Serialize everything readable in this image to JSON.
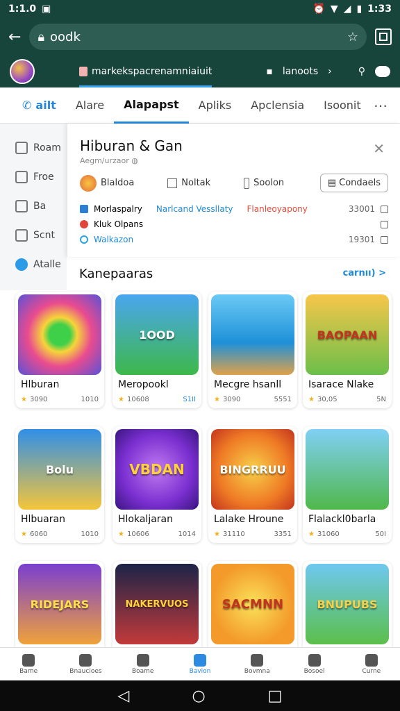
{
  "status": {
    "time": "1:1.0",
    "right_time": "1:33",
    "icons": [
      "photo-icon",
      "alarm-icon",
      "wifi-icon",
      "signal-icon",
      "battery-icon"
    ]
  },
  "browser": {
    "url": "oodk"
  },
  "header": {
    "site": "markekspacrenamniaiuit",
    "right_label": "lanoots"
  },
  "tabs": [
    "ailt",
    "Alare",
    "Alapapst",
    "Apliks",
    "Apclensia",
    "Isoonit"
  ],
  "active_tab": 2,
  "sidebar": [
    "Roam",
    "Froe",
    "Ba",
    "Scnt",
    "Atalle"
  ],
  "panel": {
    "title": "Hiburan & Gan",
    "subtitle": "Aegm/urzaor",
    "row1": [
      "Blaldoa",
      "Noltak",
      "Soolon"
    ],
    "button": "Condaels",
    "list": [
      {
        "a": "Morlaspalry",
        "b": "Narlcand Vessllaty",
        "c": "Flanleoyapony",
        "num": "33001"
      },
      {
        "a": "Kluk Olpans",
        "b": "",
        "c": "",
        "num": ""
      },
      {
        "a": "Walkazon",
        "b": "",
        "c": "",
        "num": "19301"
      }
    ]
  },
  "section": {
    "title": "Kanepaaras",
    "link": "carnıı) >"
  },
  "cards": [
    {
      "name": "Hlburan",
      "rating": "3090",
      "count": "1010",
      "thumb": ""
    },
    {
      "name": "Meropookl",
      "rating": "10608",
      "count": "S1II",
      "thumb": "1OOD"
    },
    {
      "name": "Mecgre hsanll",
      "rating": "3090",
      "count": "5551",
      "thumb": ""
    },
    {
      "name": "Isarace Nlake",
      "rating": "30,05",
      "count": "5N",
      "thumb": "BAOPAAN"
    },
    {
      "name": "Hlbuaran",
      "rating": "6060",
      "count": "1010",
      "thumb": "Bolu"
    },
    {
      "name": "Hlokaljaran",
      "rating": "10606",
      "count": "1014",
      "thumb": "VBDAN"
    },
    {
      "name": "Lalake Hroune",
      "rating": "31110",
      "count": "3351",
      "thumb": "BINGRRUU"
    },
    {
      "name": "Flalackl0barla",
      "rating": "31060",
      "count": "50I",
      "thumb": ""
    },
    {
      "name": "",
      "rating": "",
      "count": "",
      "thumb": "RIDEJARS"
    },
    {
      "name": "",
      "rating": "",
      "count": "",
      "thumb": "NAKERVUOS"
    },
    {
      "name": "",
      "rating": "",
      "count": "",
      "thumb": "SACMNN"
    },
    {
      "name": "",
      "rating": "",
      "count": "",
      "thumb": "BNUPUBS"
    }
  ],
  "bottom_nav": [
    "Bame",
    "Bnaucioes",
    "Boame",
    "Bavion",
    "Bovmna",
    "Bosoel",
    "Curne"
  ],
  "colors": {
    "header": "#17443b",
    "accent": "#2587d9"
  }
}
